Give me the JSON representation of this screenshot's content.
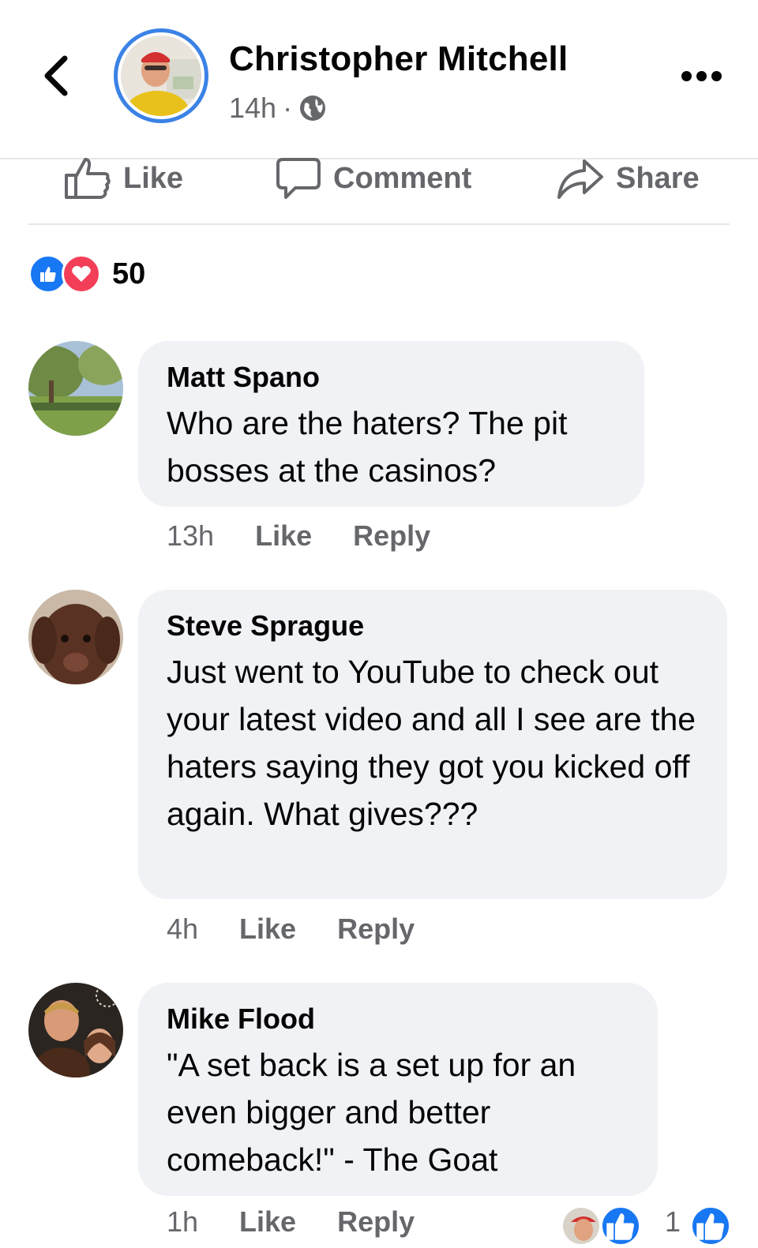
{
  "post": {
    "author": "Christopher Mitchell",
    "time": "14h",
    "separator": "·",
    "audience_icon": "globe-icon"
  },
  "actions": {
    "like": "Like",
    "comment": "Comment",
    "share": "Share"
  },
  "reactions": {
    "types": [
      "like-reaction-icon",
      "love-reaction-icon"
    ],
    "count": "50"
  },
  "comments": [
    {
      "name": "Matt Spano",
      "text": "Who are the haters? The pit bosses at the casinos?",
      "time": "13h",
      "like": "Like",
      "reply": "Reply"
    },
    {
      "name": "Steve Sprague",
      "text": "Just went to YouTube to check out your latest video and all I see are the haters saying they got you kicked off again. What gives???",
      "time": "4h",
      "like": "Like",
      "reply": "Reply"
    },
    {
      "name": "Mike Flood",
      "text": "\"A set back is a set up for an even bigger and better comeback!\" - The Goat",
      "time": "1h",
      "like": "Like",
      "reply": "Reply",
      "reaction_count": "1"
    }
  ],
  "colors": {
    "accent": "#1877f2",
    "love": "#f33e58",
    "bubble": "#f0f2f5",
    "muted": "#65676b"
  }
}
